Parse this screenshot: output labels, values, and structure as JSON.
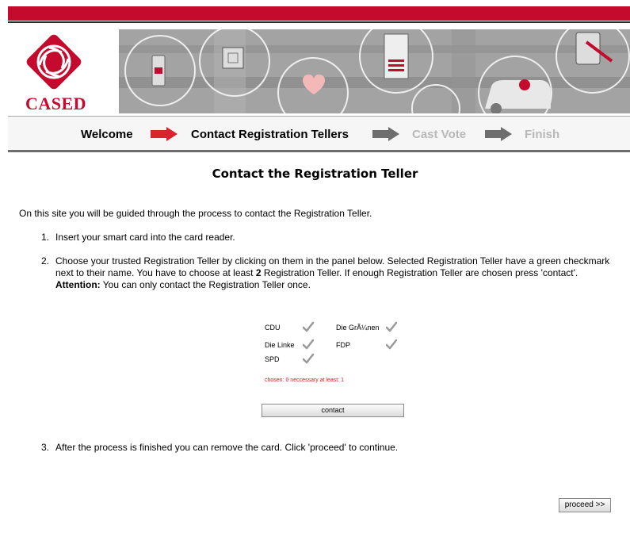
{
  "header": {
    "logo_text": "CASED"
  },
  "wizard": {
    "steps": [
      {
        "label": "Welcome",
        "state": "done"
      },
      {
        "label": "Contact Registration Tellers",
        "state": "active"
      },
      {
        "label": "Cast Vote",
        "state": "inactive"
      },
      {
        "label": "Finish",
        "state": "inactive"
      }
    ],
    "colors": {
      "active_arrow": "#d9232e",
      "inactive_arrow": "#6e6e6e",
      "inactive_text": "#b8b8b8"
    }
  },
  "page": {
    "title": "Contact the Registration Teller",
    "intro": "On this site you will be guided through the process to contact the Registration Teller.",
    "steps": [
      {
        "number": "1.",
        "text": "Insert your smart card into the card reader."
      },
      {
        "number": "2.",
        "text_part1": "Choose your trusted Registration Teller by clicking on them in the panel below. Selected Registration Teller have a green checkmark next to their name. You have to choose at least ",
        "text_bold": "2",
        "text_part2": " Registration Teller. If enough Registration Teller are chosen press 'contact'.",
        "attention_label": "Attention:",
        "attention_text": " You can only contact the Registration Teller once."
      },
      {
        "number": "3.",
        "text": "After the process is finished you can remove the card. Click 'proceed' to continue."
      }
    ]
  },
  "tellers": [
    {
      "name": "CDU",
      "selected": false
    },
    {
      "name": "Die GrÃ¼nen",
      "selected": false
    },
    {
      "name": "Die Linke",
      "selected": false
    },
    {
      "name": "FDP",
      "selected": false
    },
    {
      "name": "SPD",
      "selected": false
    }
  ],
  "selection_status": "chosen: 0 neccessary at least: 1",
  "buttons": {
    "contact": "contact",
    "proceed": "proceed >>"
  },
  "colors": {
    "brand_red": "#c40b2d",
    "status_red": "#d91c1c",
    "check_gray": "#9a9a9a"
  }
}
